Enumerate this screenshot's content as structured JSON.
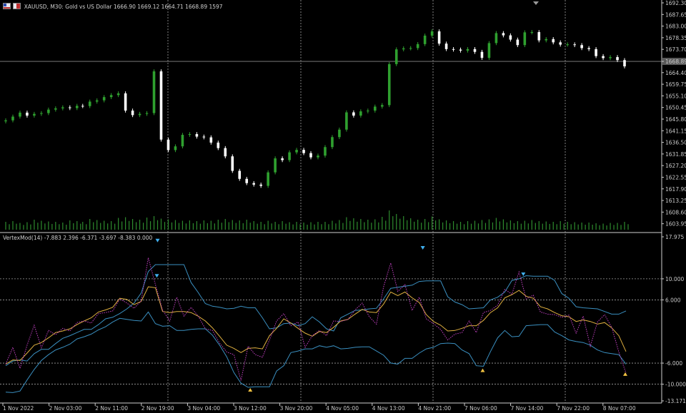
{
  "main_header": {
    "symbol": "XAUUSD, M30:",
    "description": "Gold vs US Dollar",
    "ohlc": "1666.90 1669.12 1664.71 1668.89",
    "ticks": "1597"
  },
  "indicator_header": {
    "name": "VertexMod(14)",
    "values": "-7.883 2.396 -6.371 -3.697 -8.383 0.000"
  },
  "price_axis": [
    "1692.30",
    "1687.65",
    "1683.00",
    "1678.35",
    "1673.70",
    "1668.89",
    "1664.40",
    "1659.75",
    "1655.10",
    "1650.45",
    "1645.80",
    "1641.15",
    "1636.50",
    "1631.85",
    "1627.20",
    "1622.55",
    "1617.90",
    "1613.25",
    "1608.60",
    "1603.95"
  ],
  "current_price": "1668.89",
  "indicator_axis": [
    "17.975",
    "10.000",
    "6.000",
    "-6.000",
    "-10.000",
    "-13.171"
  ],
  "time_axis": [
    "1 Nov 2022",
    "2 Nov 03:00",
    "2 Nov 11:00",
    "2 Nov 19:00",
    "3 Nov 04:00",
    "3 Nov 12:00",
    "3 Nov 20:00",
    "4 Nov 05:00",
    "4 Nov 13:00",
    "4 Nov 21:00",
    "7 Nov 06:00",
    "7 Nov 14:00",
    "7 Nov 22:00",
    "8 Nov 07:00"
  ],
  "colors": {
    "bull": "#2fa02f",
    "bear": "#ffffff",
    "volume": "#2e8b2e",
    "grid": "#a0a0a0",
    "band": "#3a8fc0",
    "signal": "#e0b040",
    "fast": "#c040c0",
    "axis_text": "#c8c8c8",
    "current_price_bg": "#5a5a5a"
  },
  "chart_data": [
    {
      "type": "candlestick",
      "title": "XAUUSD, M30",
      "series": [
        {
          "name": "close",
          "x": [
            0,
            10,
            20,
            30,
            40,
            50,
            60,
            70,
            80,
            90,
            100,
            108,
            118,
            128,
            138,
            148,
            158,
            168,
            178,
            188,
            198,
            208,
            218,
            228,
            238,
            248,
            258,
            268,
            278,
            288,
            298,
            308,
            318,
            328,
            338,
            348,
            358,
            368,
            378,
            388,
            398,
            408,
            418,
            428,
            438,
            448,
            458,
            468,
            478,
            488,
            498,
            508,
            518,
            528,
            538,
            548,
            558,
            568,
            578,
            588,
            598,
            608,
            618,
            628,
            638,
            648,
            658,
            668,
            678,
            688,
            698,
            708,
            718,
            728,
            738,
            748,
            758,
            768,
            778,
            788,
            798,
            808,
            818,
            828,
            838,
            848,
            858,
            868
          ],
          "values": [
            1645.3,
            1646.8,
            1648.4,
            1647.2,
            1647.9,
            1648.2,
            1649.6,
            1650.1,
            1650.5,
            1650.2,
            1651.1,
            1651.0,
            1652.8,
            1653.3,
            1654.6,
            1655.4,
            1656.1,
            1649.2,
            1647.4,
            1647.9,
            1648.2,
            1664.9,
            1637.6,
            1633.4,
            1634.9,
            1639.5,
            1639.8,
            1638.8,
            1638.5,
            1636.4,
            1634.2,
            1630.9,
            1625.1,
            1621.9,
            1620.2,
            1619.6,
            1619.1,
            1624.5,
            1630.1,
            1629.4,
            1632.5,
            1633.5,
            1632.2,
            1630.5,
            1631.2,
            1634.6,
            1638.6,
            1641.6,
            1648.5,
            1647.2,
            1648.9,
            1649.2,
            1650.8,
            1651.4,
            1667.8,
            1673.7,
            1674.1,
            1674.2,
            1675.8,
            1679.2,
            1680.9,
            1676.0,
            1673.8,
            1673.6,
            1673.2,
            1673.8,
            1672.7,
            1670.3,
            1676.2,
            1680.2,
            1679.3,
            1677.6,
            1675.4,
            1680.5,
            1680.6,
            1677.3,
            1677.8,
            1676.5,
            1675.6,
            1675.7,
            1675.4,
            1674.2,
            1673.8,
            1671.0,
            1670.2,
            1670.6,
            1669.4,
            1666.9
          ]
        }
      ],
      "volume": [
        22,
        24,
        19,
        21,
        28,
        25,
        23,
        22,
        20,
        26,
        24,
        22,
        30,
        27,
        25,
        24,
        33,
        35,
        30,
        28,
        34,
        38,
        31,
        29,
        27,
        25,
        26,
        24,
        26,
        25,
        28,
        30,
        27,
        26,
        28,
        24,
        22,
        25,
        22,
        24,
        21,
        22,
        20,
        21,
        22,
        22,
        25,
        27,
        35,
        32,
        30,
        28,
        29,
        36,
        54,
        44,
        38,
        32,
        28,
        30,
        37,
        29,
        26,
        24,
        22,
        24,
        25,
        27,
        29,
        33,
        29,
        26,
        24,
        25,
        27,
        24,
        23,
        22,
        24,
        22,
        21,
        20,
        20,
        18,
        17,
        19,
        19,
        22
      ],
      "ylim": [
        1601.0,
        1692.3
      ],
      "xlabel": "",
      "ylabel": ""
    },
    {
      "type": "line",
      "title": "VertexMod(14)",
      "x": [
        0,
        10,
        20,
        30,
        40,
        50,
        60,
        70,
        80,
        90,
        100,
        110,
        120,
        130,
        140,
        150,
        160,
        170,
        180,
        190,
        200,
        210,
        220,
        230,
        240,
        250,
        260,
        270,
        280,
        290,
        300,
        310,
        320,
        330,
        340,
        350,
        360,
        370,
        380,
        390,
        400,
        410,
        420,
        430,
        440,
        450,
        460,
        470,
        480,
        490,
        500,
        510,
        520,
        530,
        540,
        550,
        560,
        570,
        580,
        590,
        600,
        610,
        620,
        630,
        640,
        650,
        660,
        670,
        680,
        690,
        700,
        710,
        720,
        730,
        740,
        750,
        760,
        770,
        780,
        790,
        800,
        810,
        820,
        830,
        840,
        850,
        860,
        870
      ],
      "series": [
        {
          "name": "",
          "values": [
            -6.5,
            -5.6,
            -5.4,
            -5.6,
            -4.2,
            -3.4,
            -3.4,
            -2.3,
            -1.3,
            -0.8,
            -0.2,
            0.4,
            0.4,
            1.3,
            2.4,
            2.7,
            3.4,
            4.3,
            5.4,
            7.3,
            11.4,
            12.7,
            12.7,
            12.7,
            12.7,
            12.7,
            9.3,
            7.4,
            5.3,
            4.8,
            4.6,
            4.3,
            4.4,
            4.8,
            4.5,
            4.5,
            2.6,
            0.5,
            0.7,
            1.5,
            1.6,
            1.1,
            1.5,
            2.8,
            1.8,
            0.5,
            0.1,
            2.6,
            3.3,
            4.0,
            4.1,
            4.3,
            4.4,
            6.2,
            8.2,
            8.4,
            8.6,
            8.8,
            9.5,
            9.6,
            9.6,
            9.6,
            6.6,
            5.6,
            5.1,
            4.3,
            4.4,
            4.5,
            6.0,
            6.5,
            7.5,
            9.7,
            10.0,
            10.6,
            10.5,
            10.5,
            10.5,
            9.7,
            7.2,
            6.3,
            4.7,
            4.5,
            4.4,
            4.3,
            3.8,
            3.3,
            3.3,
            3.9
          ]
        },
        {
          "name": "",
          "values": [
            -6.2,
            -5.4,
            -5.5,
            -4.1,
            -2.6,
            -2.1,
            -1.2,
            -0.2,
            0.1,
            0.5,
            1.3,
            2.0,
            2.6,
            3.7,
            4.1,
            4.6,
            6.3,
            6.1,
            5.1,
            5.7,
            8.5,
            8.3,
            3.8,
            3.6,
            3.8,
            3.8,
            3.6,
            2.9,
            2.0,
            0.7,
            -0.9,
            -2.6,
            -3.2,
            -4.0,
            -3.2,
            -3.1,
            -3.3,
            -0.8,
            0.6,
            2.4,
            1.6,
            0.6,
            -0.3,
            -0.9,
            0.0,
            -0.2,
            0.8,
            2.0,
            2.3,
            3.3,
            4.2,
            3.7,
            3.6,
            5.2,
            7.5,
            6.8,
            7.5,
            6.4,
            5.5,
            3.2,
            1.9,
            1.2,
            0.1,
            0.2,
            0.6,
            1.1,
            1.1,
            2.1,
            3.6,
            4.5,
            6.4,
            7.0,
            7.8,
            6.7,
            6.3,
            4.7,
            4.3,
            3.6,
            3.0,
            2.8,
            1.9,
            2.2,
            1.9,
            1.4,
            1.7,
            0.7,
            -0.8,
            -3.8
          ]
        },
        {
          "name": "",
          "values": [
            -11.5,
            -11.6,
            -11.3,
            -9.2,
            -7.2,
            -5.5,
            -4.4,
            -3.5,
            -3.0,
            -2.4,
            -1.4,
            -1.0,
            -0.5,
            0.3,
            0.9,
            1.8,
            2.5,
            2.3,
            2.1,
            2.0,
            3.7,
            1.5,
            1.0,
            1.1,
            0.2,
            0.2,
            0.4,
            0.5,
            0.5,
            -0.7,
            -2.6,
            -4.8,
            -7.8,
            -9.8,
            -10.6,
            -10.5,
            -10.5,
            -10.5,
            -7.5,
            -6.5,
            -4.0,
            -3.7,
            -3.3,
            -3.3,
            -2.7,
            -3.0,
            -2.7,
            -3.3,
            -3.2,
            -3.0,
            -2.9,
            -2.9,
            -3.7,
            -4.5,
            -6.0,
            -6.2,
            -5.1,
            -5.1,
            -4.1,
            -3.3,
            -3.0,
            -2.3,
            -2.2,
            -2.3,
            -3.5,
            -4.2,
            -6.5,
            -6.6,
            -3.8,
            -1.2,
            0.2,
            -1.0,
            -0.9,
            1.1,
            1.2,
            1.3,
            1.3,
            -0.1,
            -0.8,
            -1.6,
            -1.9,
            -2.1,
            -2.6,
            -3.5,
            -4.0,
            -4.2,
            -4.4,
            -6.2
          ]
        },
        {
          "name": "",
          "values": [
            -6.2,
            -3.0,
            -7.0,
            -2.6,
            1.2,
            -3.1,
            0.2,
            -0.6,
            0.6,
            0.1,
            1.7,
            2.0,
            1.6,
            3.4,
            3.6,
            3.9,
            6.2,
            5.4,
            4.4,
            5.8,
            14.0,
            8.9,
            4.1,
            2.0,
            6.5,
            2.9,
            4.6,
            2.9,
            0.5,
            0.2,
            -2.2,
            -3.9,
            -4.4,
            -9.3,
            -2.8,
            -4.4,
            -4.9,
            -1.6,
            2.0,
            3.4,
            1.1,
            1.8,
            -3.0,
            -0.8,
            0.2,
            -0.8,
            2.0,
            1.9,
            2.3,
            4.1,
            5.4,
            2.8,
            1.4,
            8.5,
            13.0,
            7.6,
            8.9,
            4.0,
            6.5,
            2.4,
            1.5,
            0.4,
            -1.6,
            -0.5,
            -0.2,
            2.0,
            -0.2,
            3.6,
            4.0,
            5.0,
            8.0,
            7.1,
            11.3,
            6.2,
            6.9,
            3.7,
            3.3,
            3.2,
            2.7,
            3.1,
            -0.3,
            2.9,
            -2.8,
            1.8,
            3.2,
            0.8,
            -3.9,
            -7.9
          ]
        }
      ],
      "ylim": [
        -13.171,
        17.975
      ],
      "levels": [
        10.0,
        6.0,
        -6.0,
        -10.0
      ],
      "xlabel": "",
      "ylabel": ""
    }
  ]
}
